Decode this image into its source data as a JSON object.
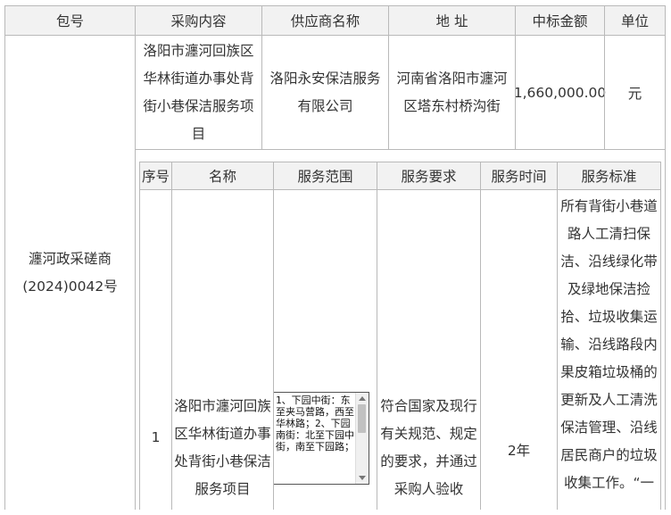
{
  "main_table": {
    "headers": {
      "package_no": "包号",
      "content": "采购内容",
      "supplier": "供应商名称",
      "address": "地 址",
      "amount": "中标金额",
      "unit": "单位"
    },
    "row": {
      "package_no_line1": "瀍河政采磋商",
      "package_no_line2": "(2024)0042号",
      "content": "洛阳市瀍河回族区华林街道办事处背街小巷保洁服务项目",
      "supplier": "洛阳永安保洁服务有限公司",
      "address": "河南省洛阳市瀍河区塔东村桥沟街",
      "amount": "1,660,000.00",
      "unit": "元"
    }
  },
  "sub_table": {
    "headers": {
      "seq": "序号",
      "name": "名称",
      "scope": "服务范围",
      "requirement": "服务要求",
      "time": "服务时间",
      "standard": "服务标准"
    },
    "row": {
      "seq": "1",
      "name": "洛阳市瀍河回族区华林街道办事处背街小巷保洁服务项目",
      "scope": "1、下园中街：东至夹马营路，西至华林路；2、下园南街：北至下园中街，南至下园路；",
      "requirement": "符合国家及现行有关规范、规定的要求，并通过采购人验收",
      "time": "2年",
      "standard": "所有背街小巷道路人工清扫保洁、沿线绿化带及绿地保洁捡拾、垃圾收集运输、沿线路段内果皮箱垃圾桶的更新及人工清洗保洁管理、沿线居民商户的垃圾收集工作。“一"
    }
  }
}
